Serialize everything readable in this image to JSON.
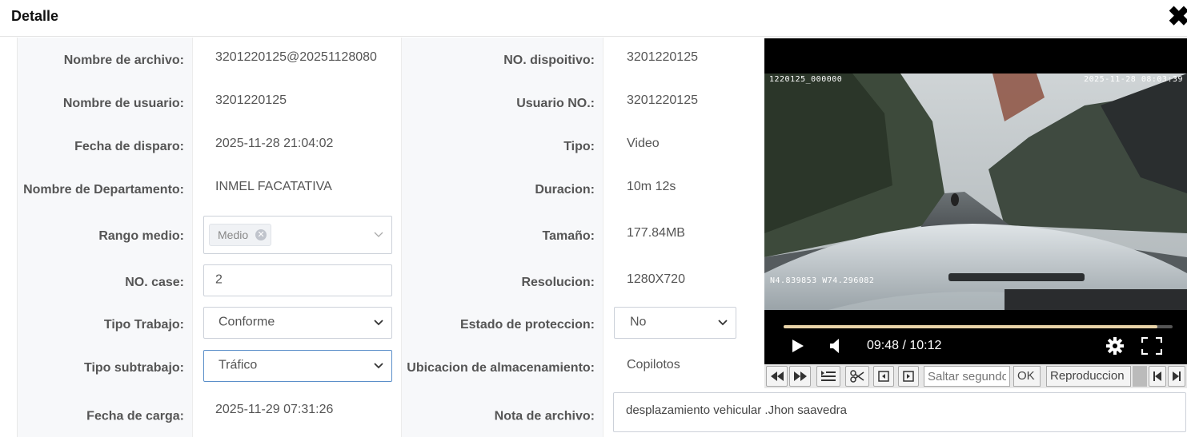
{
  "dialog": {
    "title": "Detalle",
    "close_glyph": "✖"
  },
  "rows": [
    {
      "l1": "Nombre de archivo:",
      "v1": "3201220125@20251128080",
      "l2": "NO. dispoitivo:",
      "v2": "3201220125"
    },
    {
      "l1": "Nombre de usuario:",
      "v1": "3201220125",
      "l2": "Usuario NO.:",
      "v2": "3201220125"
    },
    {
      "l1": "Fecha de disparo:",
      "v1": "2025-11-28 21:04:02",
      "l2": "Tipo:",
      "v2": "Video"
    },
    {
      "l1": "Nombre de Departamento:",
      "v1": "INMEL FACATATIVA",
      "l2": "Duracion:",
      "v2": "10m 12s"
    },
    {
      "l1": "Rango medio:",
      "v1_tag": "Medio",
      "l2": "Tamaño:",
      "v2": "177.84MB"
    },
    {
      "l1": "NO. case:",
      "v1_input": "2",
      "l2": "Resolucion:",
      "v2": "1280X720"
    },
    {
      "l1": "Tipo Trabajo:",
      "v1_select": "Conforme",
      "l2": "Estado de proteccion:",
      "v2_select": "No"
    },
    {
      "l1": "Tipo subtrabajo:",
      "v1_select": "Tráfico",
      "l2": "Ubicacion de almacenamiento:",
      "v2": "Copilotos"
    },
    {
      "l1": "Fecha de carga:",
      "v1": "2025-11-29 07:31:26",
      "l2": "Nota de archivo:",
      "v2_note": "desplazamiento vehicular .Jhon saavedra"
    }
  ],
  "video": {
    "osd_top_left": "1220125_000000",
    "osd_top_right": "2025-11-28 08:03:39",
    "osd_bottom_left": "N4.839853  W74.296082",
    "time_display": "09:48 / 10:12",
    "progress": 0.96
  },
  "toolbar": {
    "seek_placeholder": "Saltar segundos",
    "ok_label": "OK",
    "playback_label": "Reproduccion"
  },
  "colors": {
    "label_bg": "#f7f8fa",
    "border": "#e8e8e8",
    "progress": "#e8d3a8"
  }
}
